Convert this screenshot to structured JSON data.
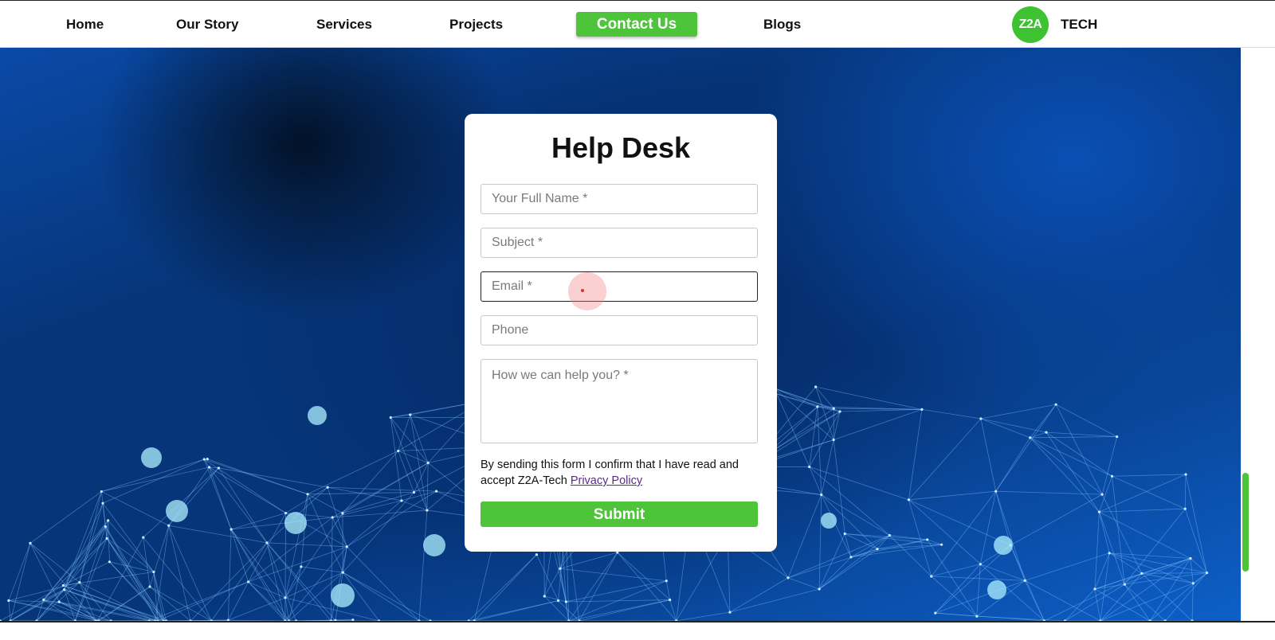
{
  "nav": {
    "items": [
      {
        "label": "Home"
      },
      {
        "label": "Our Story"
      },
      {
        "label": "Services"
      },
      {
        "label": "Projects"
      },
      {
        "label": "Contact Us",
        "active": true
      },
      {
        "label": "Blogs"
      }
    ],
    "logo": {
      "mark": "Z2A",
      "text": "TECH"
    }
  },
  "form": {
    "title": "Help Desk",
    "fields": {
      "full_name": {
        "placeholder": "Your Full Name *",
        "value": ""
      },
      "subject": {
        "placeholder": "Subject *",
        "value": ""
      },
      "email": {
        "placeholder": "Email *",
        "value": "",
        "focused": true
      },
      "phone": {
        "placeholder": "Phone",
        "value": ""
      },
      "message": {
        "placeholder": "How we can help you? *",
        "value": ""
      }
    },
    "consent_text": "By sending this form I confirm that I have read and accept Z2A-Tech ",
    "privacy_link": "Privacy Policy",
    "submit_label": "Submit"
  },
  "colors": {
    "accent_green": "#4ec43a",
    "hero_blue": "#063579",
    "link_purple": "#5b2a8a"
  },
  "icons": {
    "logo": "z2a-logo-icon"
  }
}
